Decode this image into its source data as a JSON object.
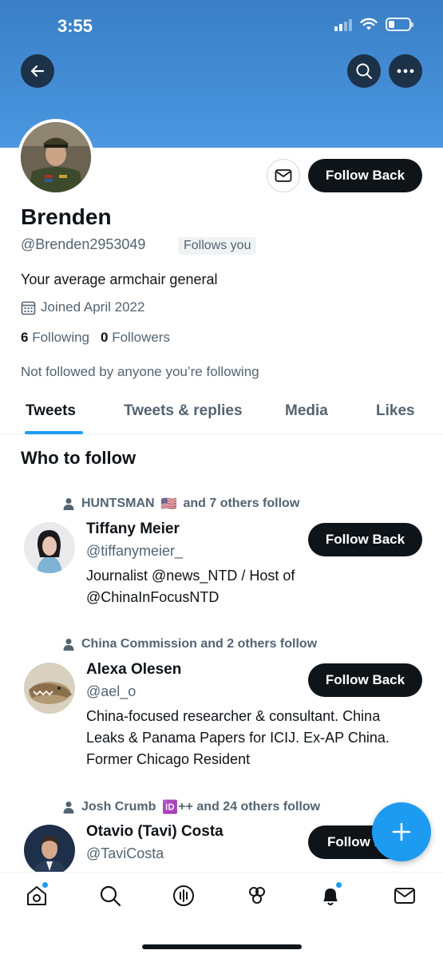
{
  "status_bar": {
    "time": "3:55"
  },
  "profile": {
    "name": "Brenden",
    "handle": "@Brenden2953049",
    "follows_you_badge": "Follows you",
    "bio": "Your average armchair general",
    "joined": "Joined April 2022",
    "following_count": "6",
    "following_label": "Following",
    "followers_count": "0",
    "followers_label": "Followers",
    "not_followed_text": "Not followed by anyone you’re following",
    "follow_button_label": "Follow Back"
  },
  "tabs": [
    {
      "label": "Tweets",
      "active": true
    },
    {
      "label": "Tweets & replies",
      "active": false
    },
    {
      "label": "Media",
      "active": false
    },
    {
      "label": "Likes",
      "active": false
    }
  ],
  "who_to_follow": {
    "title": "Who to follow",
    "accounts": [
      {
        "social_context_prefix": "HUNTSMAN",
        "social_context_emoji": "🇺🇸",
        "social_context_suffix": "and 7 others follow",
        "name": "Tiffany Meier",
        "handle": "@tiffanymeier_",
        "bio": "Journalist @news_NTD / Host of @ChinaInFocusNTD",
        "button_label": "Follow Back"
      },
      {
        "social_context_prefix": "China Commission and 2 others follow",
        "social_context_emoji": "",
        "social_context_suffix": "",
        "name": "Alexa Olesen",
        "handle": "@ael_o",
        "bio": "China-focused researcher & consultant. China Leaks & Panama Papers for ICIJ. Ex-AP China. Former Chicago Resident",
        "button_label": "Follow Back"
      },
      {
        "social_context_prefix": "Josh Crumb",
        "social_context_emoji": "🆔",
        "social_context_suffix": "++ and 24 others follow",
        "name": "Otavio (Tavi) Costa",
        "handle": "@TaviCosta",
        "bio": "",
        "button_label": "Follow B"
      }
    ]
  },
  "icons": {
    "back": "arrow-left-icon",
    "search": "search-icon",
    "more": "more-horizontal-icon",
    "message": "envelope-icon",
    "calendar": "calendar-icon",
    "compose": "plus-icon",
    "nav": [
      "home-icon",
      "search-icon",
      "spaces-icon",
      "communities-icon",
      "notifications-icon",
      "messages-icon"
    ]
  },
  "colors": {
    "accent": "#1d9bf0",
    "banner": "#4a97e0",
    "text": "#0f1419",
    "secondary": "#536471"
  }
}
